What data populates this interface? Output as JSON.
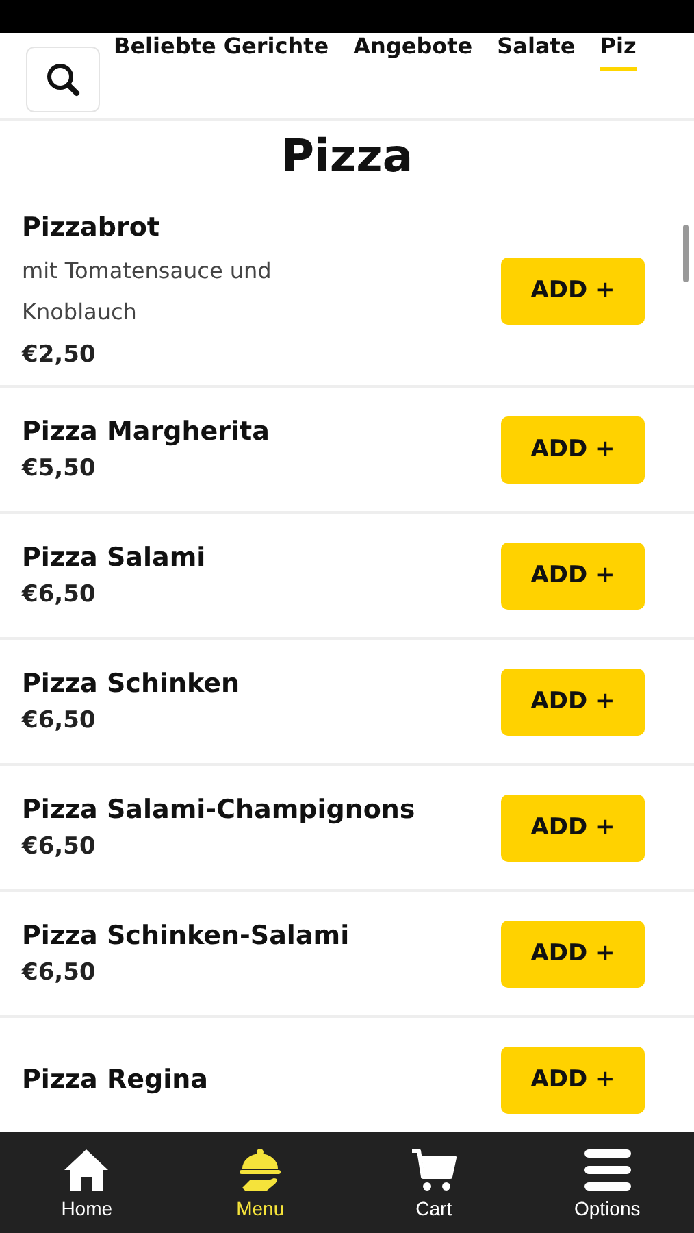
{
  "tabs": [
    {
      "label": "Beliebte Gerichte",
      "selected": false
    },
    {
      "label": "Angebote",
      "selected": false
    },
    {
      "label": "Salate",
      "selected": false
    },
    {
      "label": "Piz",
      "selected": true
    }
  ],
  "section_title": "Pizza",
  "items": [
    {
      "name": "Pizzabrot",
      "description": "mit Tomatensauce und Knoblauch",
      "price": "€2,50",
      "button": "ADD +"
    },
    {
      "name": "Pizza Margherita",
      "price": "€5,50",
      "button": "ADD +"
    },
    {
      "name": "Pizza Salami",
      "price": "€6,50",
      "button": "ADD +"
    },
    {
      "name": "Pizza Schinken",
      "price": "€6,50",
      "button": "ADD +"
    },
    {
      "name": "Pizza Salami-Champignons",
      "price": "€6,50",
      "button": "ADD +"
    },
    {
      "name": "Pizza Schinken-Salami",
      "price": "€6,50",
      "button": "ADD +"
    },
    {
      "name": "Pizza Regina",
      "button": "ADD +"
    }
  ],
  "nav": [
    {
      "label": "Home",
      "kind": "home",
      "selected": false
    },
    {
      "label": "Menu",
      "kind": "menu",
      "selected": true
    },
    {
      "label": "Cart",
      "kind": "cart",
      "selected": false
    },
    {
      "label": "Options",
      "kind": "options",
      "selected": false
    }
  ]
}
